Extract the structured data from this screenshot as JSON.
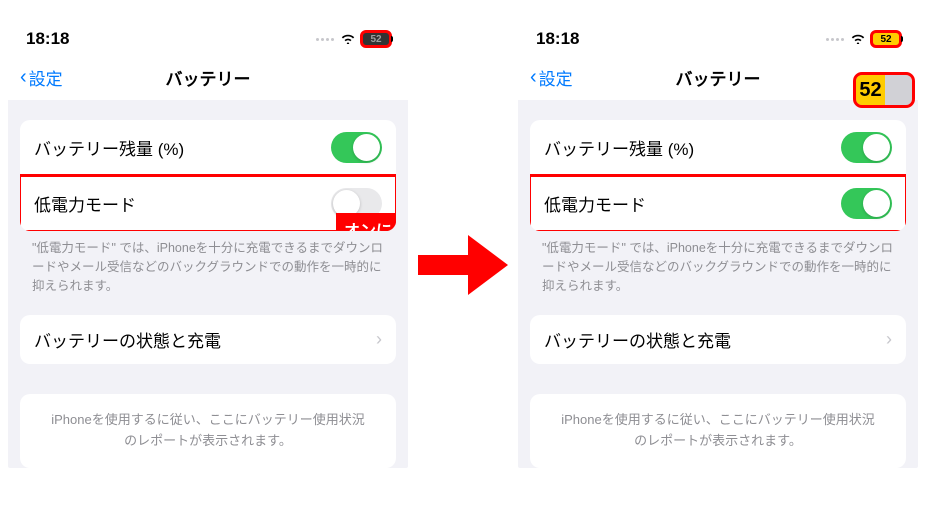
{
  "statusTime": "18:18",
  "batteryPercent": "52",
  "backLabel": "設定",
  "pageTitle": "バッテリー",
  "rows": {
    "percentLabel": "バッテリー残量 (%)",
    "lowPowerLabel": "低電力モード",
    "healthLabel": "バッテリーの状態と充電"
  },
  "lowPowerFooter": "\"低電力モード\" では、iPhoneを十分に充電できるまでダウンロードやメール受信などのバックグラウンドでの動作を一時的に抑えられます。",
  "reportPlaceholder": "iPhoneを使用するに従い、ここにバッテリー使用状況のレポートが表示されます。",
  "callout": "オンに",
  "bigBattery": "52"
}
